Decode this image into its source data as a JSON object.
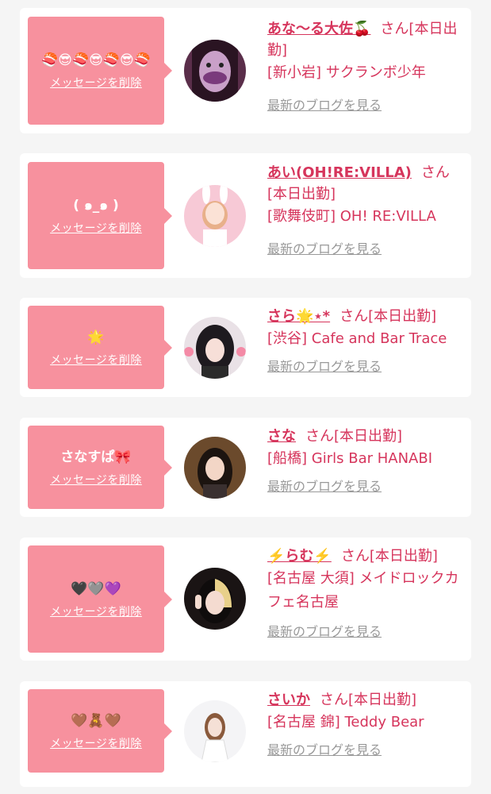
{
  "colors": {
    "bubble": "#f7919e",
    "accent_text": "#d6355c",
    "link_gray": "#999999",
    "card_bg": "#ffffff",
    "page_bg": "#f5f5f5"
  },
  "items": [
    {
      "message": "🍣😎🍣😎🍣😎🍣",
      "delete_label": "メッセージを削除",
      "name": "あな〜る大佐🍒",
      "san": "さん",
      "status": "[本日出勤]",
      "shop": "[新小岩] サクランボ少年",
      "blog_label": "最新のブログを見る",
      "avatar_icon": "avatar-purple-face"
    },
    {
      "message": "( ๑_๑ )",
      "delete_label": "メッセージを削除",
      "name": "あい(OH!RE:VILLA)",
      "san": "さん",
      "status": "[本日出勤]",
      "shop": "[歌舞伎町] OH! RE:VILLA",
      "blog_label": "最新のブログを見る",
      "avatar_icon": "avatar-bunny-girl"
    },
    {
      "message": "🌟",
      "delete_label": "メッセージを削除",
      "name": "さら🌟⋆*",
      "san": "さん",
      "status": "[本日出勤]",
      "shop": "[渋谷] Cafe and Bar Trace",
      "blog_label": "最新のブログを見る",
      "avatar_icon": "avatar-bear-ears"
    },
    {
      "message": "さなすぱ🎀",
      "delete_label": "メッセージを削除",
      "name": "さな",
      "san": "さん",
      "status": "[本日出勤]",
      "shop": "[船橋] Girls Bar HANABI",
      "blog_label": "最新のブログを見る",
      "avatar_icon": "avatar-dark-hair"
    },
    {
      "message": "🖤🩶💜",
      "delete_label": "メッセージを削除",
      "name": "⚡️らむ⚡️",
      "san": "さん",
      "status": "[本日出勤]",
      "shop": "[名古屋 大須] メイドロックカフェ名古屋",
      "blog_label": "最新のブログを見る",
      "avatar_icon": "avatar-peace-sign"
    },
    {
      "message": "🤎🧸🤎",
      "delete_label": "メッセージを削除",
      "name": "さいか",
      "san": "さん",
      "status": "[本日出勤]",
      "shop": "[名古屋 錦] Teddy Bear",
      "blog_label": "最新のブログを見る",
      "avatar_icon": "avatar-white-dress"
    }
  ]
}
